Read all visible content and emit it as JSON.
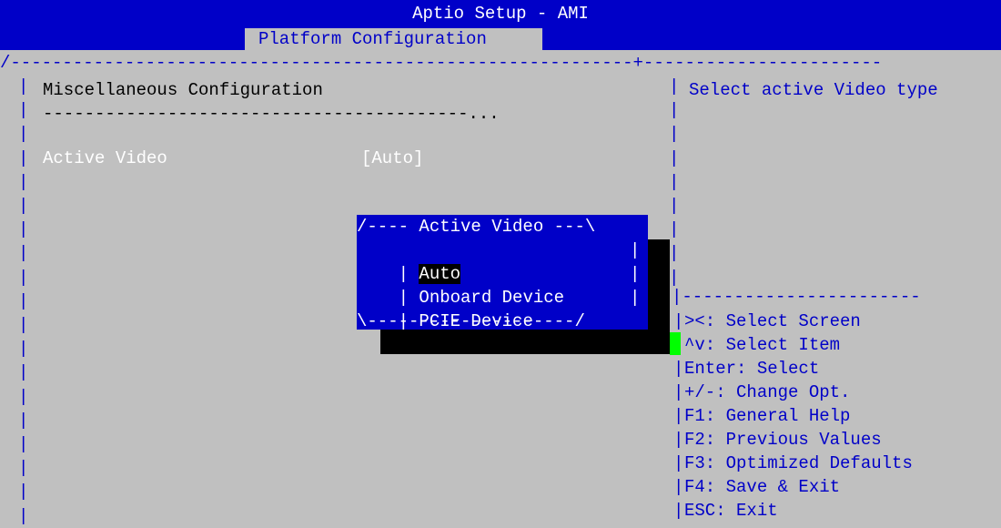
{
  "header": {
    "title": "Aptio Setup - AMI",
    "tab": "Platform Configuration"
  },
  "main": {
    "section_title": "Miscellaneous Configuration",
    "separator": "-----------------------------------------...",
    "items": [
      {
        "label": "Active Video",
        "value": "[Auto]"
      }
    ]
  },
  "popup": {
    "top": "/---- Active Video ---\\",
    "options": [
      "Auto",
      "Onboard Device",
      "PCIE Device"
    ],
    "selected": "Auto",
    "bottom": "\\--------------------/"
  },
  "help": {
    "text": "Select active Video type"
  },
  "keys": [
    "><: Select Screen",
    "^v: Select Item",
    "Enter: Select",
    "+/-: Change Opt.",
    "F1: General Help",
    "F2: Previous Values",
    "F3: Optimized Defaults",
    "F4: Save & Exit",
    "ESC: Exit"
  ],
  "colors": {
    "blue": "#0000c8",
    "gray": "#c0c0c0",
    "cursor": "#00ff00"
  }
}
